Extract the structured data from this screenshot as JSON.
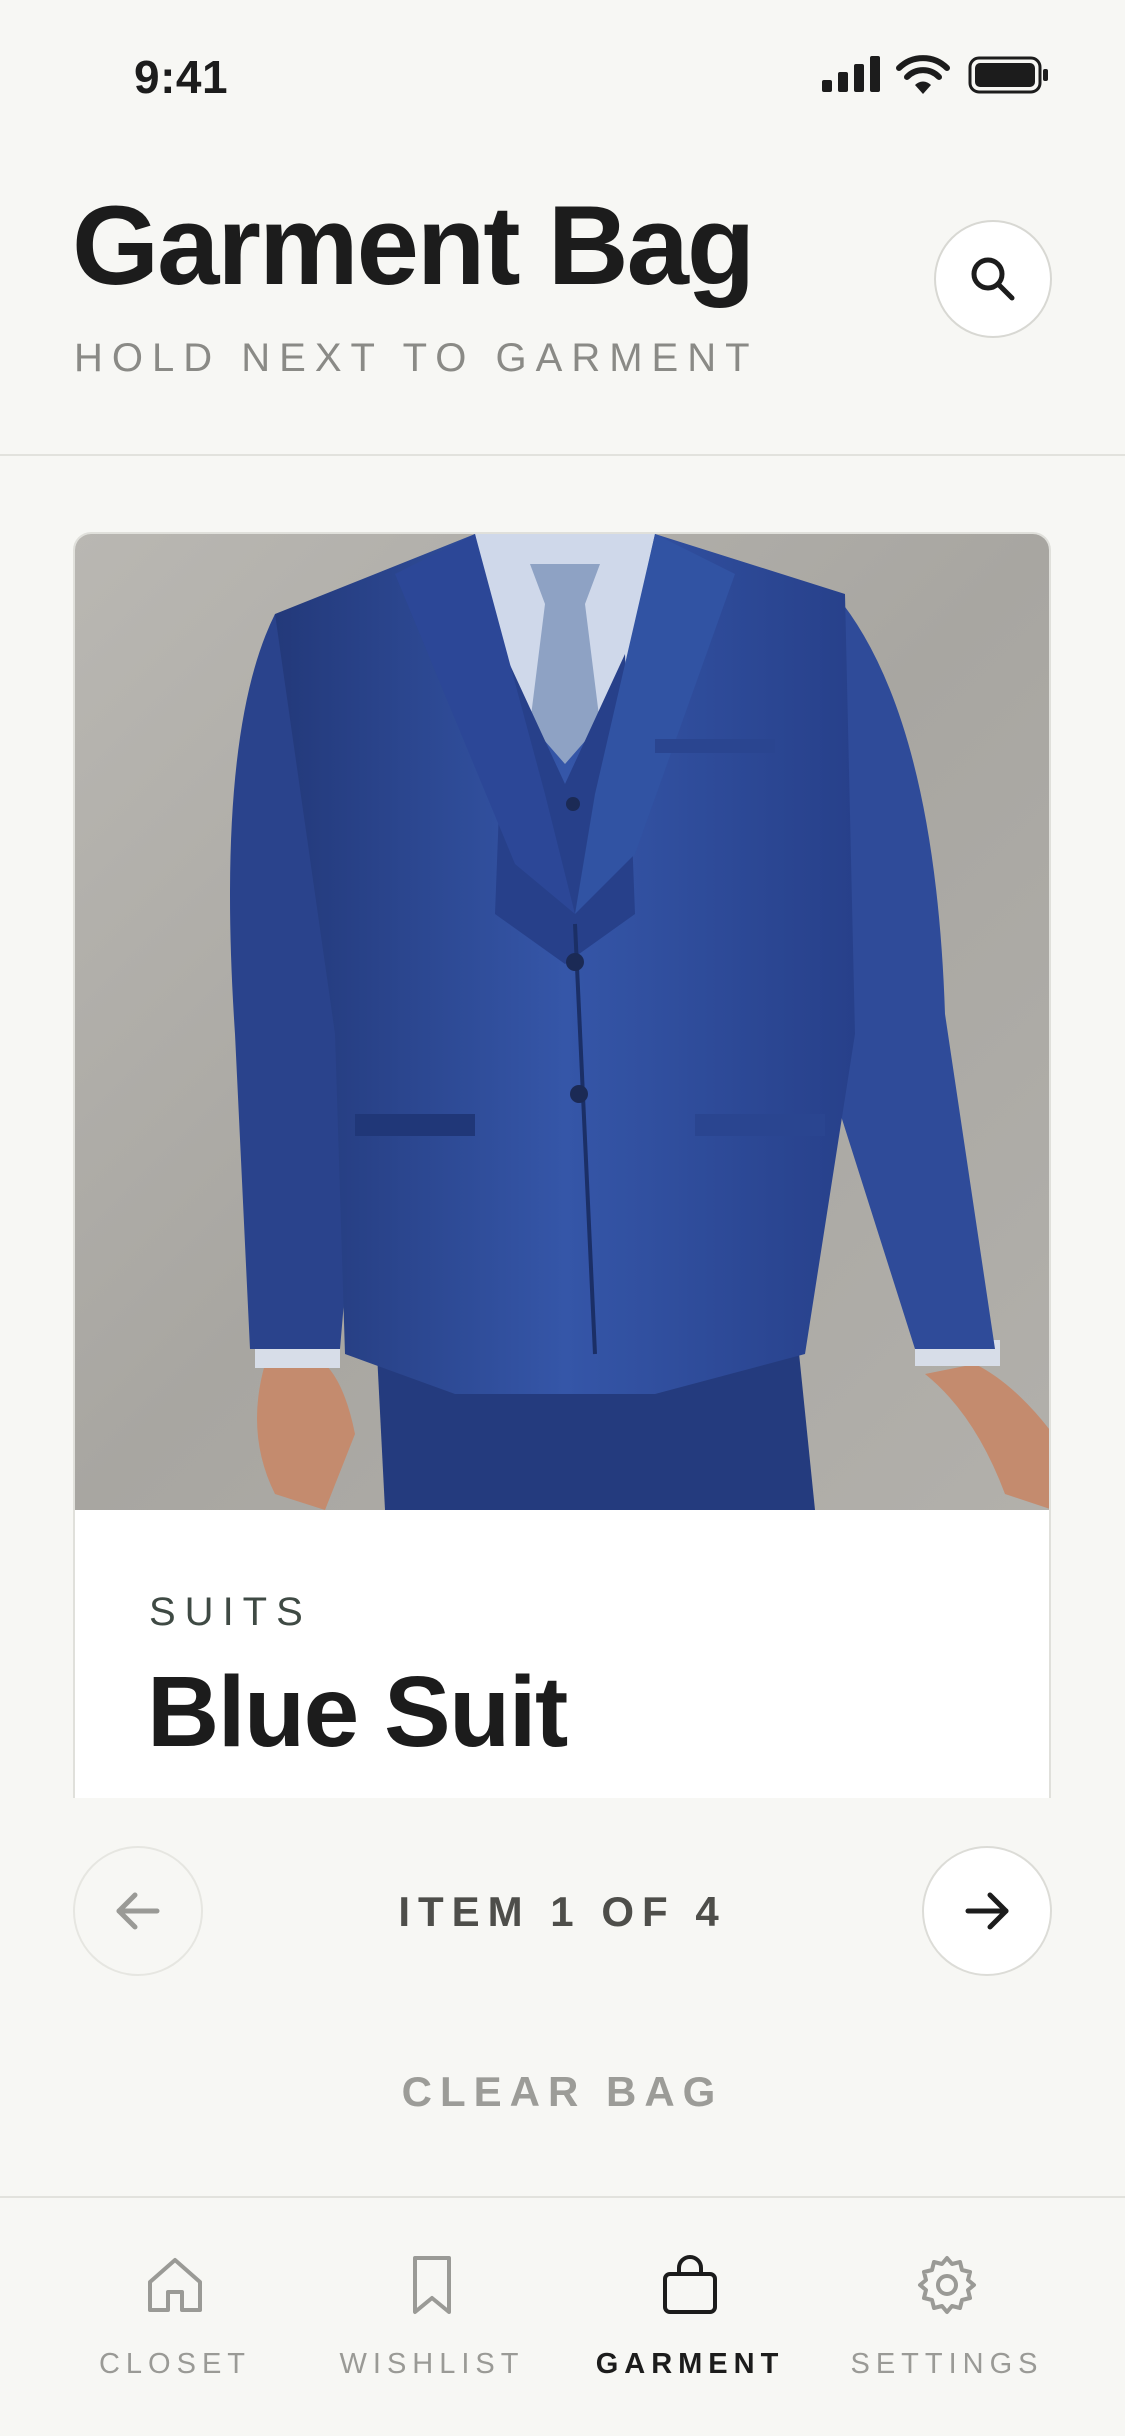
{
  "status_bar": {
    "time": "9:41"
  },
  "header": {
    "title": "Garment Bag",
    "subtitle": "HOLD NEXT TO GARMENT",
    "search_icon": "search-icon"
  },
  "card": {
    "photo_alt": "blue-suit-photo",
    "category": "SUITS",
    "title": "Blue Suit"
  },
  "pager": {
    "label": "ITEM 1 OF 4",
    "prev_icon": "arrow-left-icon",
    "next_icon": "arrow-right-icon"
  },
  "actions": {
    "clear_bag": "CLEAR BAG"
  },
  "tabs": [
    {
      "label": "CLOSET",
      "icon": "house-icon",
      "active": false
    },
    {
      "label": "WISHLIST",
      "icon": "bookmark-icon",
      "active": false
    },
    {
      "label": "GARMENT",
      "icon": "bag-icon",
      "active": true
    },
    {
      "label": "SETTINGS",
      "icon": "gear-icon",
      "active": false
    }
  ],
  "colors": {
    "background": "#f7f7f4",
    "text_primary": "#1c1c1c",
    "text_muted": "#9a9a96",
    "suit_blue": "#2e4f9e"
  }
}
